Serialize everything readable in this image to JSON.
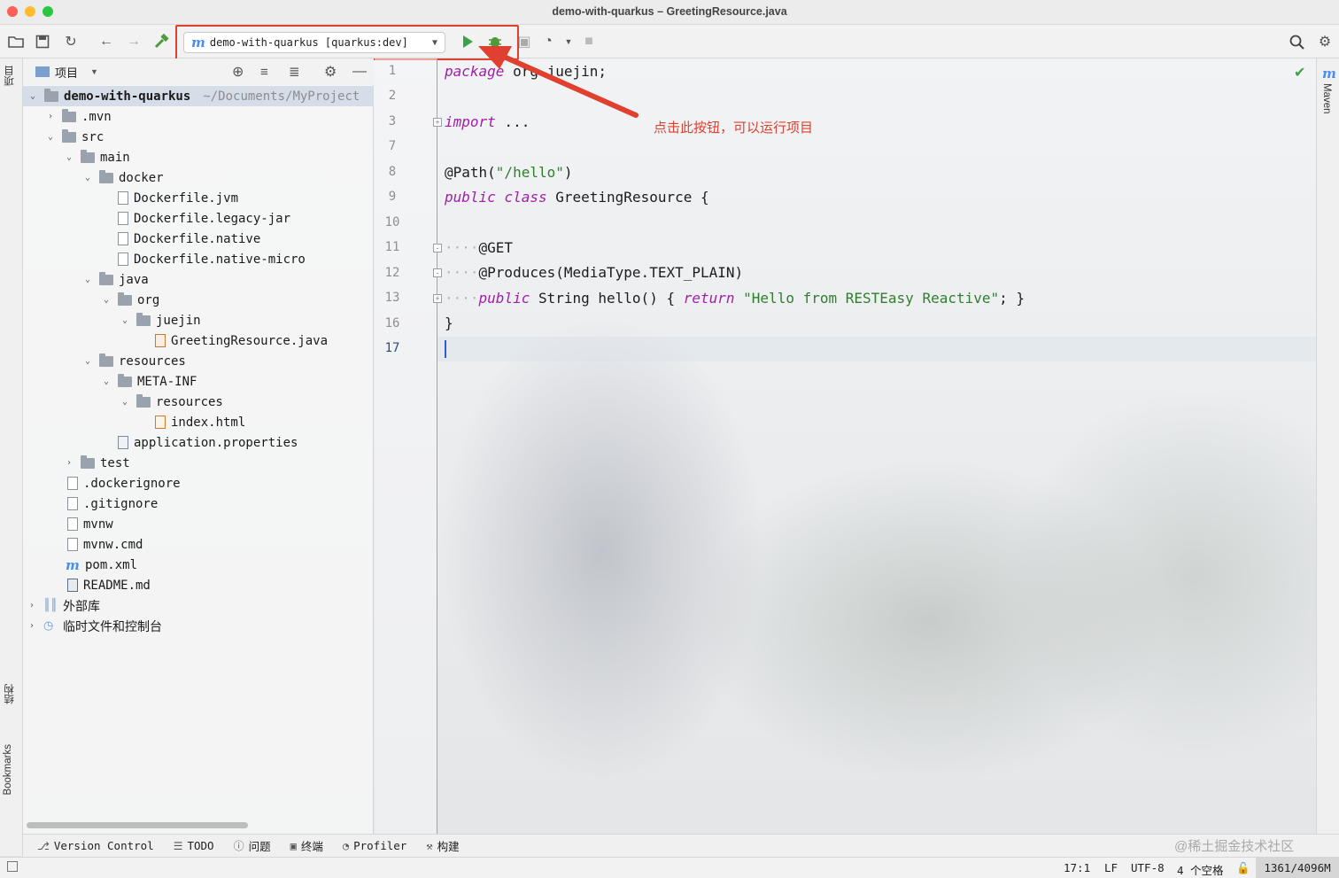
{
  "window": {
    "title": "demo-with-quarkus – GreetingResource.java"
  },
  "toolbar": {
    "run_config": "demo-with-quarkus [quarkus:dev]",
    "run_config_icon": "maven-m-icon",
    "icons": [
      "open-icon",
      "save-icon",
      "sync-icon",
      "back-icon",
      "forward-icon",
      "build-hammer-icon",
      "run-icon",
      "debug-icon",
      "coverage-icon",
      "profile-icon",
      "stop-icon",
      "search-icon",
      "settings-icon"
    ]
  },
  "project": {
    "header_label": "项目",
    "root_name": "demo-with-quarkus",
    "root_path": "~/Documents/MyProject",
    "items": [
      ".mvn",
      "src",
      "main",
      "docker",
      "Dockerfile.jvm",
      "Dockerfile.legacy-jar",
      "Dockerfile.native",
      "Dockerfile.native-micro",
      "java",
      "org",
      "juejin",
      "GreetingResource.java",
      "resources",
      "META-INF",
      "resources",
      "index.html",
      "application.properties",
      "test",
      ".dockerignore",
      ".gitignore",
      "mvnw",
      "mvnw.cmd",
      "pom.xml",
      "README.md",
      "外部库",
      "临时文件和控制台"
    ]
  },
  "side_tabs": {
    "left": [
      "项目",
      "结构",
      "Bookmarks"
    ],
    "right": "Maven",
    "right_icon": "m"
  },
  "editor": {
    "line_numbers": [
      "1",
      "2",
      "3",
      "7",
      "8",
      "9",
      "10",
      "11",
      "12",
      "13",
      "16",
      "17"
    ],
    "code": {
      "l1_kw": "package",
      "l1_rest": " org.juejin;",
      "l3_kw": "import",
      "l3_rest": " ...",
      "l8_a": "@Path(",
      "l8_str": "\"/hello\"",
      "l8_b": ")",
      "l9_kw1": "public",
      "l9_kw2": "class",
      "l9_rest": " GreetingResource {",
      "l11": "@GET",
      "l12": "@Produces(MediaType.TEXT_PLAIN)",
      "l13_kw1": "public",
      "l13_mid": " String hello() { ",
      "l13_kw2": "return",
      "l13_str": "\"Hello from RESTEasy Reactive\"",
      "l13_end": "; }",
      "l16": "}"
    }
  },
  "annotation": {
    "text": "点击此按钮，可以运行项目",
    "color": "#e0402f"
  },
  "bottom_tabs": [
    "Version Control",
    "TODO",
    "问题",
    "终端",
    "Profiler",
    "构建"
  ],
  "status": {
    "position": "17:1",
    "line_sep": "LF",
    "encoding": "UTF-8",
    "indent": "4 个空格",
    "memory": "1361/4096M"
  },
  "watermark": "@稀土掘金技术社区"
}
